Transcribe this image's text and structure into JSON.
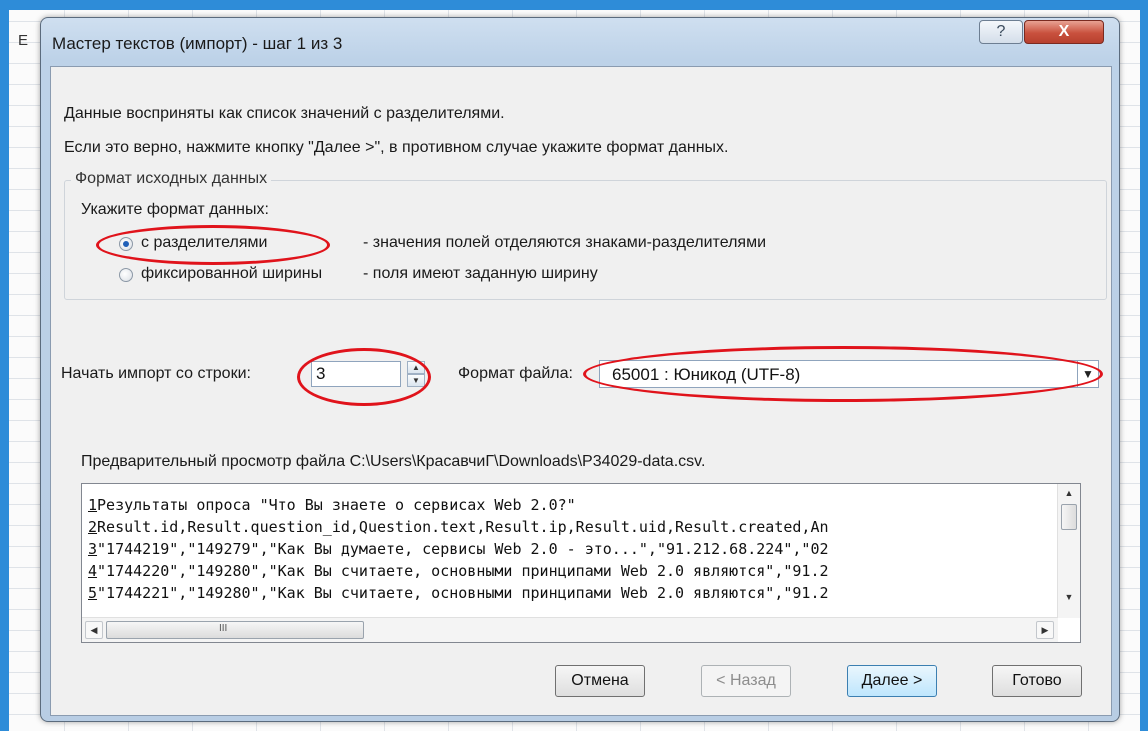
{
  "background": {
    "column_label": "E"
  },
  "dialog": {
    "title": "Мастер текстов (импорт) - шаг 1 из 3",
    "help_symbol": "?",
    "close_symbol": "X",
    "intro_line1": "Данные восприняты как список значений с разделителями.",
    "intro_line2": "Если это верно, нажмите кнопку \"Далее >\", в противном случае укажите формат данных.",
    "format_group": {
      "legend": "Формат исходных данных",
      "prompt": "Укажите формат данных:",
      "options": [
        {
          "label": "с разделителями",
          "description": "- значения полей отделяются знаками-разделителями",
          "checked": true
        },
        {
          "label": "фиксированной ширины",
          "description": "- поля имеют заданную ширину",
          "checked": false
        }
      ]
    },
    "start_row": {
      "label": "Начать импорт со строки:",
      "value": "3"
    },
    "file_format": {
      "label": "Формат файла:",
      "value": "65001 : Юникод (UTF-8)"
    },
    "preview": {
      "label": "Предварительный просмотр файла C:\\Users\\КрасавчиГ\\Downloads\\P34029-data.csv.",
      "lines": [
        {
          "num": "1",
          "text": "Результаты опроса \"Что Вы знаете о сервисах Web 2.0?\""
        },
        {
          "num": "2",
          "text": "Result.id,Result.question_id,Question.text,Result.ip,Result.uid,Result.created,An"
        },
        {
          "num": "3",
          "text": "\"1744219\",\"149279\",\"Как Вы думаете, сервисы Web 2.0 - это...\",\"91.212.68.224\",\"02"
        },
        {
          "num": "4",
          "text": "\"1744220\",\"149280\",\"Как Вы считаете, основными принципами Web 2.0 являются\",\"91.2"
        },
        {
          "num": "5",
          "text": "\"1744221\",\"149280\",\"Как Вы считаете, основными принципами Web 2.0 являются\",\"91.2"
        }
      ],
      "hscroll_grip": "III"
    },
    "buttons": {
      "cancel": "Отмена",
      "back": "< Назад",
      "next": "Далее >",
      "finish": "Готово"
    }
  },
  "colors": {
    "annotation_red": "#e0131b",
    "window_frame": "#2e8cd8"
  }
}
